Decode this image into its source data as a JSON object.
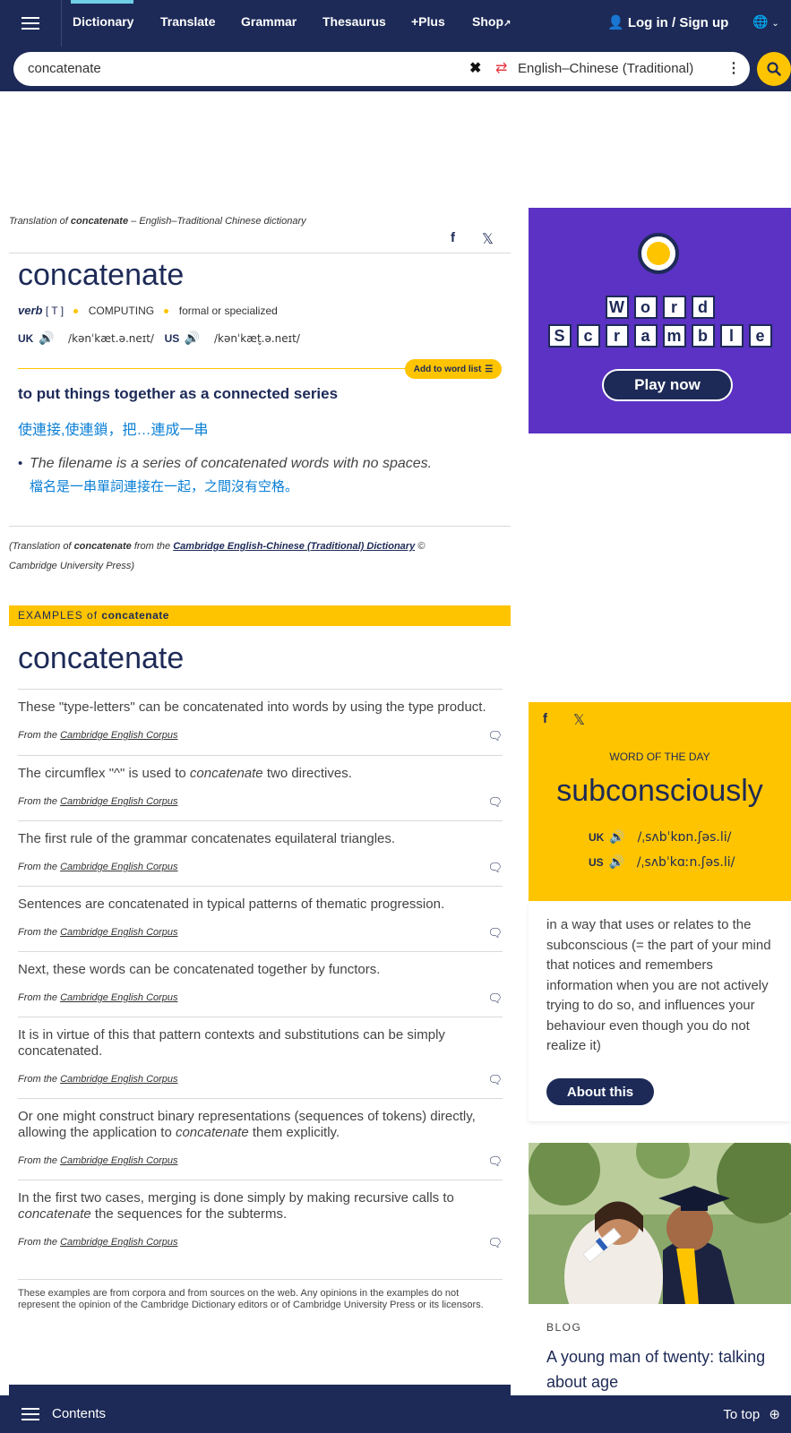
{
  "nav": {
    "items": [
      "Dictionary",
      "Translate",
      "Grammar",
      "Thesaurus",
      "+Plus",
      "Shop"
    ],
    "login": "Log in / Sign up"
  },
  "search": {
    "value": "concatenate",
    "language": "English–Chinese (Traditional)"
  },
  "entry": {
    "translation_of_prefix": "Translation of ",
    "translation_of_word": "concatenate",
    "translation_of_suffix": " – English–Traditional Chinese dictionary",
    "headword": "concatenate",
    "pos": "verb",
    "grammar": "[ T ]",
    "domain": "COMPUTING",
    "register": "formal or specialized",
    "uk_label": "UK",
    "uk_ipa": "/kənˈkæt.ə.neɪt/",
    "us_label": "US",
    "us_ipa": "/kənˈkæt̬.ə.neɪt/",
    "add_to_word_list": "Add to word list",
    "definition": "to put things together as a connected series",
    "definition_translation": "使連接,使連鎖，把…連成一串",
    "example": "The filename is a series of concatenated words with no spaces.",
    "example_translation": "檔名是一串單詞連接在一起，之間沒有空格。",
    "credit_prefix": "(Translation of ",
    "credit_word": "concatenate",
    "credit_mid": " from the ",
    "credit_link": "Cambridge English-Chinese (Traditional) Dictionary",
    "credit_suffix": " © Cambridge University Press)"
  },
  "examples": {
    "band_prefix": "EXAMPLES",
    "band_of": " of ",
    "band_word": "concatenate",
    "heading": "concatenate",
    "source_prefix": "From the ",
    "source_link": "Cambridge English Corpus",
    "items": [
      "These \"type-letters\" can be concatenated into words by using the type product.",
      "The circumflex \"^\" is used to concatenate two directives.",
      "The first rule of the grammar concatenates equilateral triangles.",
      "Sentences are concatenated in typical patterns of thematic progression.",
      "Next, these words can be concatenated together by functors.",
      "It is in virtue of this that pattern contexts and substitutions can be simply concatenated.",
      "Or one might construct binary representations (sequences of tokens) directly, allowing the application to concatenate them explicitly.",
      "In the first two cases, merging is done simply by making recursive calls to concatenate the sequences for the subterms."
    ],
    "disclaimer": "These examples are from corpora and from sources on the web. Any opinions in the examples do not represent the opinion of the Cambridge Dictionary editors or of Cambridge University Press or its licensors."
  },
  "promo": {
    "word1": [
      "W",
      "o",
      "r",
      "d"
    ],
    "word2": [
      "S",
      "c",
      "r",
      "a",
      "m",
      "b",
      "l",
      "e"
    ],
    "button": "Play now"
  },
  "wotd": {
    "label": "WORD OF THE DAY",
    "word": "subconsciously",
    "uk_label": "UK",
    "uk_ipa": "/ˌsʌbˈkɒn.ʃəs.li/",
    "us_label": "US",
    "us_ipa": "/ˌsʌbˈkɑːn.ʃəs.li/",
    "definition": "in a way that uses or relates to the subconscious (= the part of your mind that notices and remembers information when you are not actively trying to do so, and influences your behaviour even though you do not realize it)",
    "button": "About this"
  },
  "blog": {
    "label": "BLOG",
    "title": "A young man of twenty: talking about age"
  },
  "bottom": {
    "contents": "Contents",
    "to_top": "To top"
  },
  "colors": {
    "navy": "#1d2a57",
    "yellow": "#fec400",
    "purple": "#5b32c3",
    "link_blue": "#0a7fd6"
  }
}
